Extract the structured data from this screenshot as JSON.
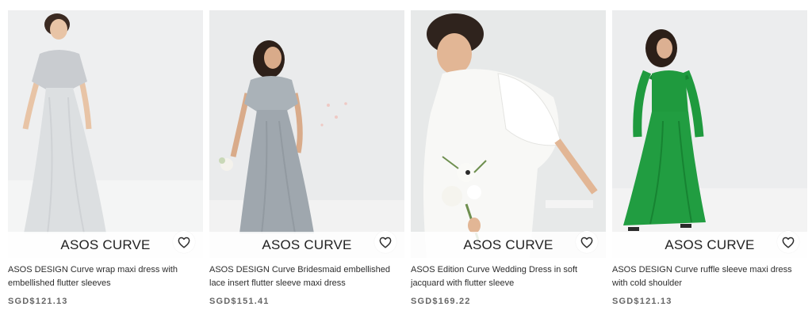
{
  "products": [
    {
      "brand": "ASOS CURVE",
      "title": "ASOS DESIGN Curve wrap maxi dress with embellished flutter sleeves",
      "price": "SGD$121.13",
      "dress_color": "#d9dcde",
      "bg_color": "#eceeef",
      "wishlist_icon": "heart-icon"
    },
    {
      "brand": "ASOS CURVE",
      "title": "ASOS DESIGN Curve Bridesmaid embellished lace insert flutter sleeve maxi dress",
      "price": "SGD$151.41",
      "dress_color": "#a6adb3",
      "bg_color": "#e8eaeb",
      "wishlist_icon": "heart-icon"
    },
    {
      "brand": "ASOS CURVE",
      "title": "ASOS Edition Curve Wedding Dress in soft jacquard with flutter sleeve",
      "price": "SGD$169.22",
      "dress_color": "#f7f7f5",
      "bg_color": "#e6e8e8",
      "wishlist_icon": "heart-icon"
    },
    {
      "brand": "ASOS CURVE",
      "title": "ASOS DESIGN Curve ruffle sleeve maxi dress with cold shoulder",
      "price": "SGD$121.13",
      "dress_color": "#1f9a3e",
      "bg_color": "#ebecec",
      "wishlist_icon": "heart-icon"
    }
  ]
}
